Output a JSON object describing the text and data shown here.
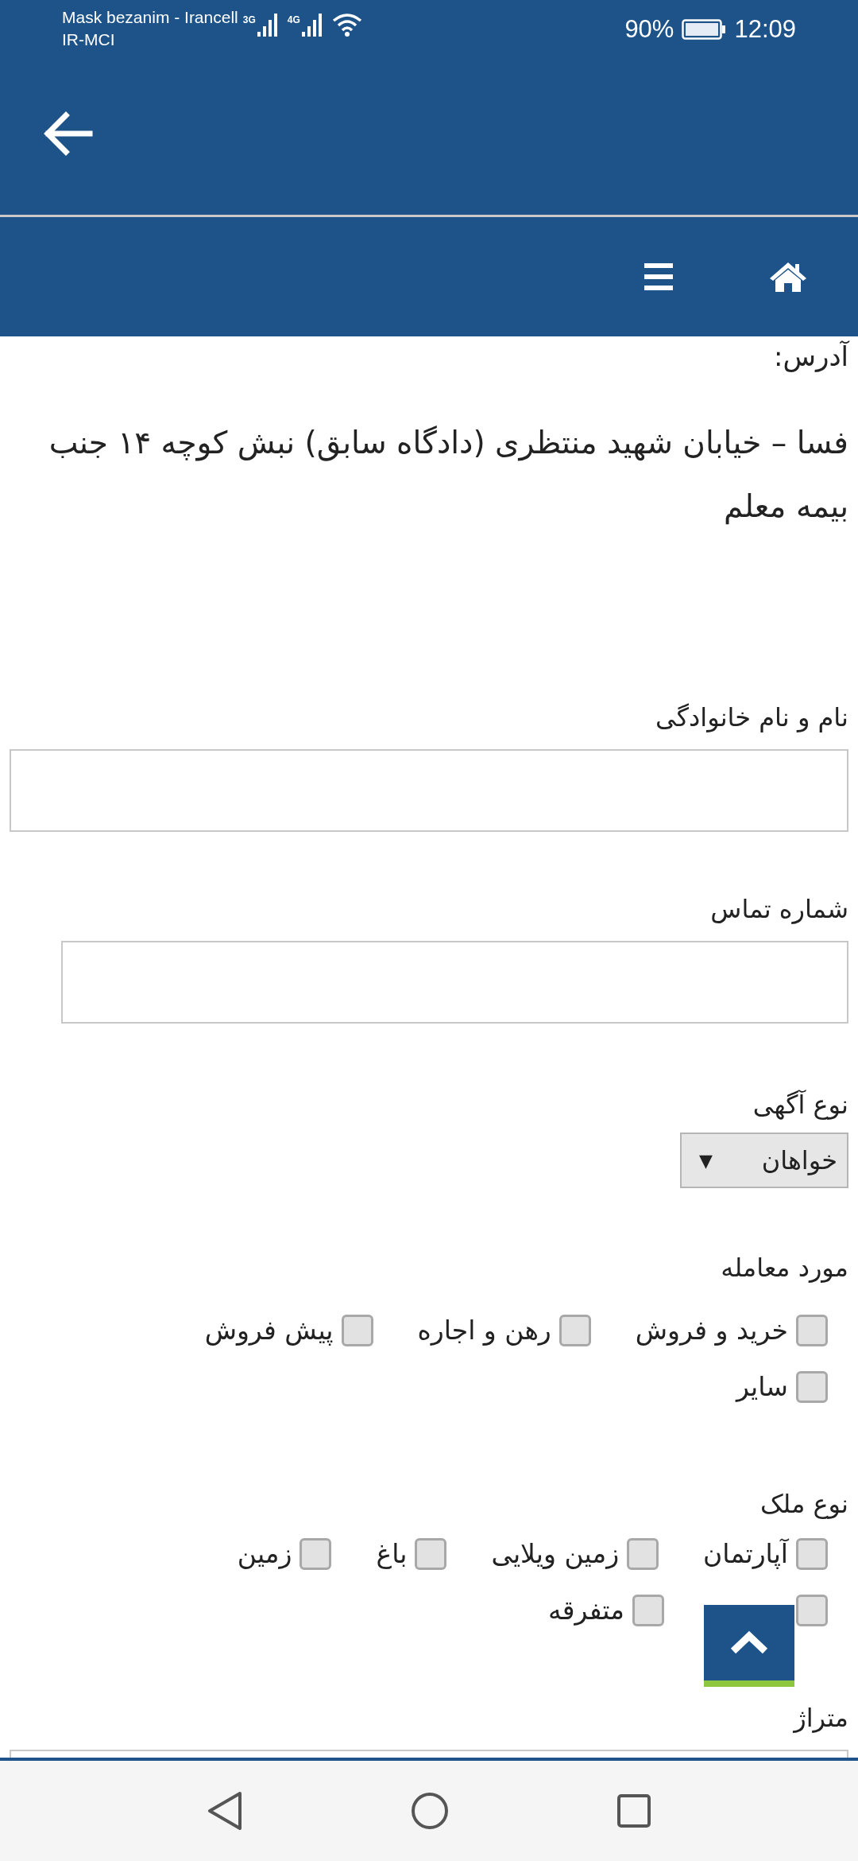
{
  "status_bar": {
    "carrier": "Mask bezanim - Irancell",
    "carrier_2": "IR-MCI",
    "network_1": "3G",
    "network_2": "4G",
    "battery": "90%",
    "time": "12:09"
  },
  "address": {
    "label": "آدرس:",
    "text": "فسا – خیابان شهید منتظری (دادگاه سابق) نبش کوچه ۱۴ جنب بیمه معلم"
  },
  "form": [
    {
      "kind": "input",
      "label": "نام و نام خانوادگی"
    },
    {
      "kind": "input",
      "label": "شماره تماس"
    },
    {
      "kind": "select",
      "label": "نوع آگهی",
      "value": "خواهان",
      "arrow": "▼"
    },
    {
      "kind": "checkboxes",
      "label": "مورد معامله",
      "options": [
        {
          "label": "خرید و فروش",
          "checked": false
        },
        {
          "label": "رهن و اجاره",
          "checked": false
        },
        {
          "label": "پیش فروش",
          "checked": false
        },
        {
          "label": "سایر",
          "checked": false
        }
      ]
    },
    {
      "kind": "checkboxes",
      "label": "نوع ملک",
      "options": [
        {
          "label": "آپارتمان",
          "checked": false
        },
        {
          "label": "زمین ویلایی",
          "checked": false
        },
        {
          "label": "باغ",
          "checked": false
        },
        {
          "label": "زمین",
          "checked": false
        },
        {
          "checked": false
        },
        {
          "label": "متفرقه",
          "checked": false
        }
      ]
    },
    {
      "kind": "input",
      "label": "متراژ"
    }
  ]
}
